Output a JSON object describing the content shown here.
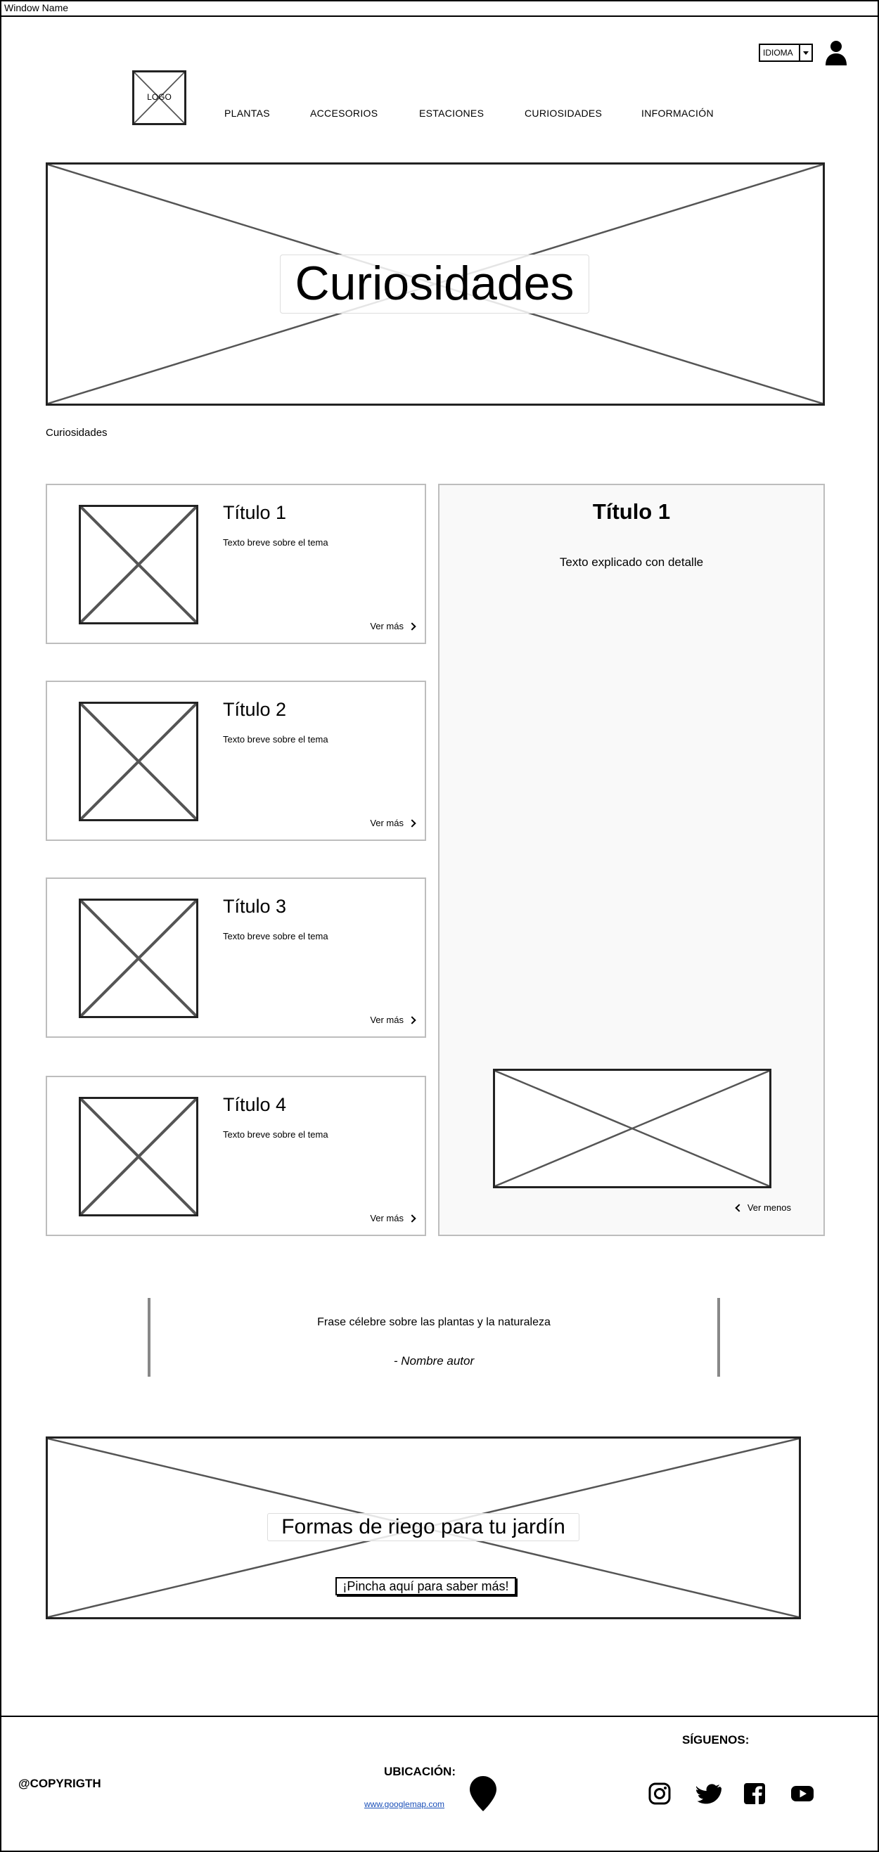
{
  "window": {
    "title": "Window Name"
  },
  "header": {
    "logo": "LOGO",
    "language": "IDIOMA",
    "nav": [
      "PLANTAS",
      "ACCESORIOS",
      "ESTACIONES",
      "CURIOSIDADES",
      "INFORMACIÓN"
    ]
  },
  "hero": {
    "title": "Curiosidades"
  },
  "breadcrumb": "Curiosidades",
  "cards": [
    {
      "title": "Título 1",
      "text": "Texto breve sobre el tema",
      "more": "Ver más"
    },
    {
      "title": "Título 2",
      "text": "Texto breve sobre el tema",
      "more": "Ver más"
    },
    {
      "title": "Título 3",
      "text": "Texto breve sobre el tema",
      "more": "Ver más"
    },
    {
      "title": "Título 4",
      "text": "Texto breve sobre el tema",
      "more": "Ver más"
    }
  ],
  "detail": {
    "title": "Título 1",
    "text": "Texto explicado con detalle",
    "less": "Ver menos"
  },
  "quote": {
    "text": "Frase célebre sobre las plantas y la naturaleza",
    "author": "- Nombre autor"
  },
  "promo": {
    "title": "Formas de riego para tu jardín",
    "button": "¡Pincha aquí para saber más!"
  },
  "footer": {
    "copyright": "@COPYRIGTH",
    "location_label": "UBICACIÓN:",
    "map_link": "www.googlemap.com",
    "follow_label": "SÍGUENOS:",
    "social_icons": [
      "instagram-icon",
      "twitter-icon",
      "facebook-icon",
      "youtube-icon"
    ]
  }
}
